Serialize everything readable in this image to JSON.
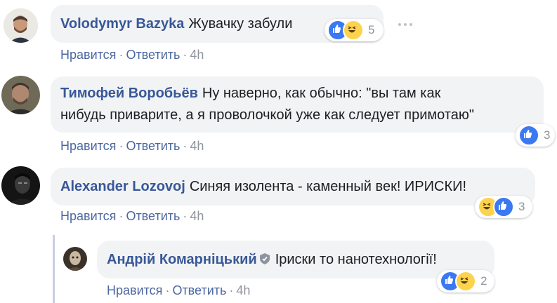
{
  "comments": [
    {
      "author": "Volodymyr Bazyka",
      "text": "Жувачку забули",
      "actions": {
        "like": "Нравится",
        "reply": "Ответить",
        "sep": "·",
        "time": "4h"
      },
      "reactions": {
        "icons": [
          "like-icon",
          "haha-icon"
        ],
        "count": "5"
      }
    },
    {
      "author": "Тимофей Воробьёв",
      "text_line1": "Ну наверно, как обычно: \"вы там как",
      "text_line2": "нибудь приварите, а я проволочкой уже как следует примотаю\"",
      "actions": {
        "like": "Нравится",
        "reply": "Ответить",
        "sep": "·",
        "time": "4h"
      },
      "reactions": {
        "icons": [
          "like-icon"
        ],
        "count": "3"
      }
    },
    {
      "author": "Alexander Lozovoj",
      "text": "Синяя изолента - каменный век! ИРИСКИ!",
      "actions": {
        "like": "Нравится",
        "reply": "Ответить",
        "sep": "·",
        "time": "4h"
      },
      "reactions": {
        "icons": [
          "haha-icon",
          "like-icon"
        ],
        "count": "3"
      }
    }
  ],
  "reply": {
    "author": "Андрій Комарніцький",
    "badge": "shield-icon",
    "text": "Іриски то нанотехнології!",
    "actions": {
      "like": "Нравится",
      "reply": "Ответить",
      "sep": "·",
      "time": "4h"
    },
    "reactions": {
      "icons": [
        "like-icon",
        "haha-icon"
      ],
      "count": "2"
    }
  },
  "colors": {
    "author": "#385898",
    "link": "#4b67a1",
    "meta": "#90949c",
    "bubble": "#f2f3f5",
    "like": "#3b79f3",
    "haha": "#fcd34d"
  }
}
